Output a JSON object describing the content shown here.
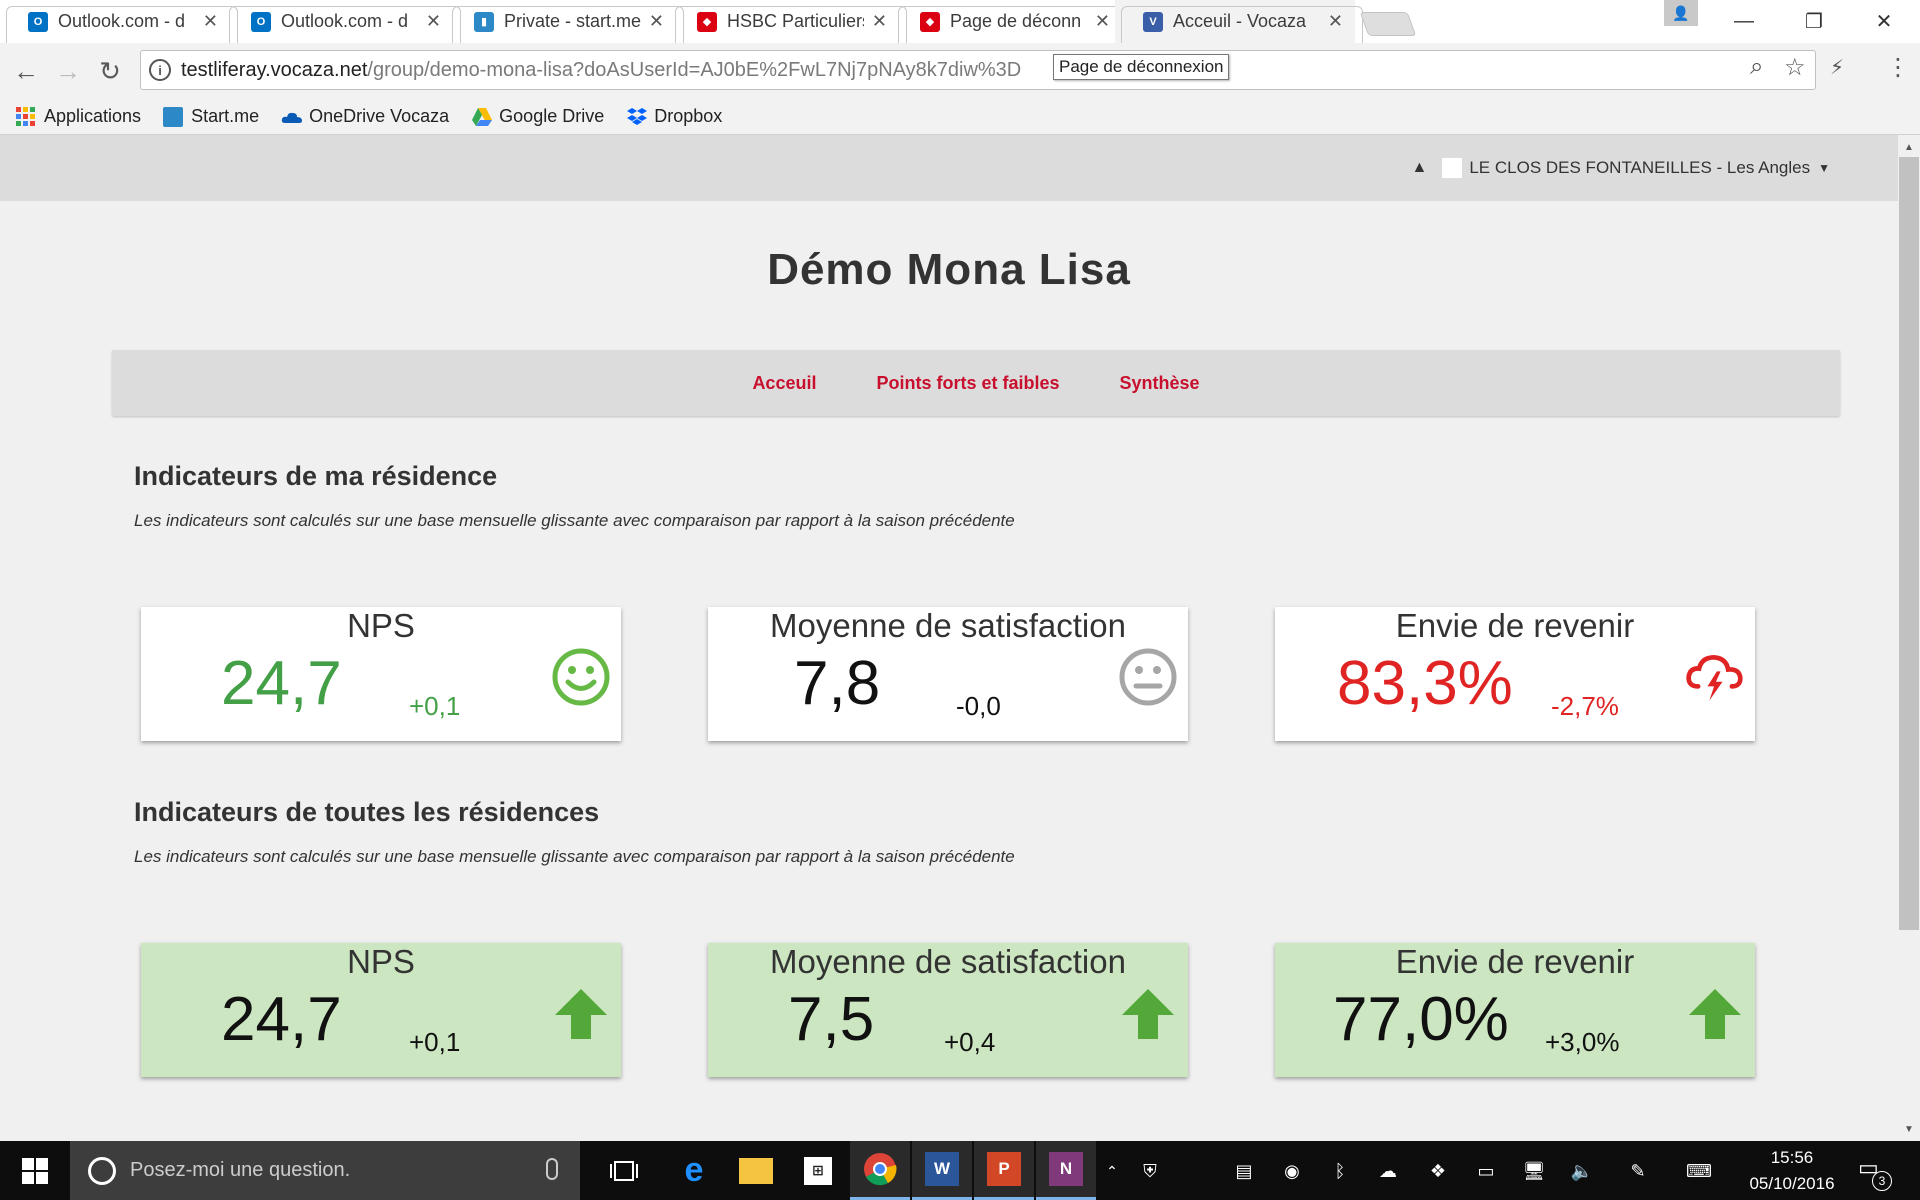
{
  "browser": {
    "tabs": [
      {
        "title": "Outlook.com - d",
        "favicon": "outlook-icon",
        "color": "#0072c6"
      },
      {
        "title": "Outlook.com - d",
        "favicon": "outlook-icon",
        "color": "#0072c6"
      },
      {
        "title": "Private - start.me",
        "favicon": "startme-icon",
        "color": "#2d88c7"
      },
      {
        "title": "HSBC Particuliers",
        "favicon": "hsbc-icon",
        "color": "#db0011"
      },
      {
        "title": "Page de déconn",
        "favicon": "hsbc-icon",
        "color": "#db0011"
      },
      {
        "title": "Acceuil - Vocaza",
        "favicon": "vocaza-icon",
        "color": "#3b5ea8"
      }
    ],
    "url_host": "testliferay.vocaza.net",
    "url_path": "/group/demo-mona-lisa?doAsUserId=AJ0bE%2FwL7Nj7pNAy8k7diw%3D",
    "tooltip": "Page de déconnexion",
    "bookmarks": [
      {
        "label": "Applications",
        "icon": "apps-grid-icon"
      },
      {
        "label": "Start.me",
        "icon": "startme-icon"
      },
      {
        "label": "OneDrive Vocaza",
        "icon": "onedrive-icon"
      },
      {
        "label": "Google Drive",
        "icon": "google-drive-icon"
      },
      {
        "label": "Dropbox",
        "icon": "dropbox-icon"
      }
    ]
  },
  "page": {
    "user_menu_label": "LE CLOS DES FONTANEILLES - Les Angles",
    "title": "Démo Mona Lisa",
    "nav": [
      "Acceuil",
      "Points forts et faibles",
      "Synthèse"
    ],
    "sections": [
      {
        "title": "Indicateurs de ma résidence",
        "subtitle": "Les indicateurs sont calculés sur une base mensuelle glissante avec comparaison par rapport à la saison précédente",
        "cards": [
          {
            "title": "NPS",
            "value": "24,7",
            "delta": "+0,1",
            "color": "#43a047",
            "icon": "smiley-happy-icon"
          },
          {
            "title": "Moyenne de satisfaction",
            "value": "7,8",
            "delta": "-0,0",
            "color": "#111111",
            "icon": "smiley-neutral-icon"
          },
          {
            "title": "Envie de revenir",
            "value": "83,3%",
            "delta": "-2,7%",
            "color": "#e02424",
            "icon": "storm-cloud-icon"
          }
        ]
      },
      {
        "title": "Indicateurs de toutes les résidences",
        "subtitle": "Les indicateurs sont calculés sur une base mensuelle glissante avec comparaison par rapport à la saison précédente",
        "cards": [
          {
            "title": "NPS",
            "value": "24,7",
            "delta": "+0,1",
            "color": "#111111",
            "icon": "arrow-up-icon"
          },
          {
            "title": "Moyenne de satisfaction",
            "value": "7,5",
            "delta": "+0,4",
            "color": "#111111",
            "icon": "arrow-up-icon"
          },
          {
            "title": "Envie de revenir",
            "value": "77,0%",
            "delta": "+3,0%",
            "color": "#111111",
            "icon": "arrow-up-icon"
          }
        ]
      }
    ]
  },
  "taskbar": {
    "search_placeholder": "Posez-moi une question.",
    "time": "15:56",
    "date": "05/10/2016",
    "notification_count": "3"
  }
}
